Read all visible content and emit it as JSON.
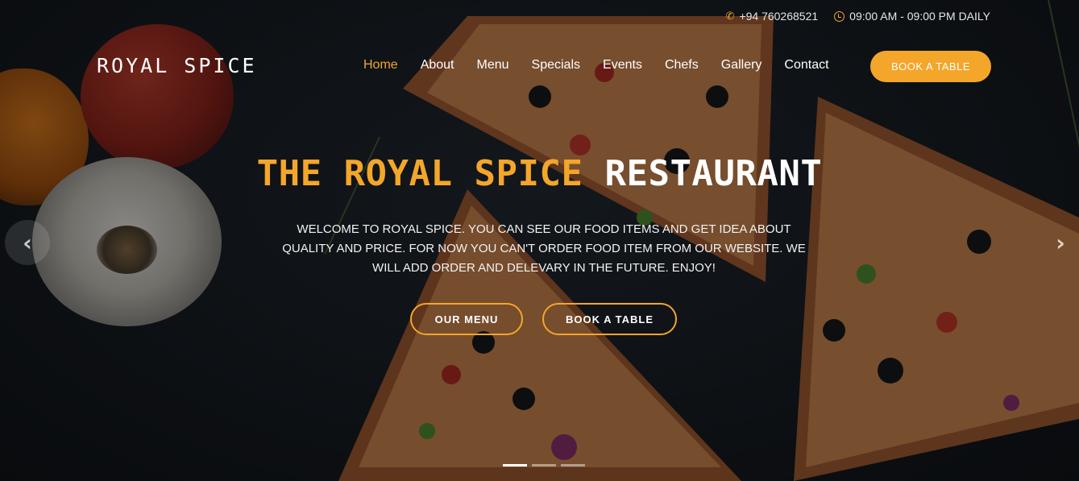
{
  "topbar": {
    "phone": "+94 760268521",
    "hours": "09:00 AM - 09:00 PM DAILY"
  },
  "header": {
    "logo": "ROYAL SPICE",
    "nav": {
      "home": "Home",
      "about": "About",
      "menu": "Menu",
      "specials": "Specials",
      "events": "Events",
      "chefs": "Chefs",
      "gallery": "Gallery",
      "contact": "Contact"
    },
    "book_button": "BOOK A TABLE"
  },
  "hero": {
    "title_accent": "THE ROYAL SPICE",
    "title_plain": "RESTAURANT",
    "welcome": "WELCOME TO ROYAL SPICE. YOU CAN SEE OUR FOOD ITEMS AND GET IDEA ABOUT QUALITY AND PRICE. FOR NOW YOU CAN'T ORDER FOOD ITEM FROM OUR WEBSITE. WE WILL ADD ORDER AND DELEVARY IN THE FUTURE. ENJOY!",
    "btn_menu": "OUR MENU",
    "btn_book": "BOOK A TABLE"
  },
  "carousel": {
    "prev_icon": "chevron-left-icon",
    "next_icon": "chevron-right-icon",
    "slides": 3,
    "active": 1
  },
  "colors": {
    "accent": "#f4a62a",
    "text": "#ffffff"
  }
}
